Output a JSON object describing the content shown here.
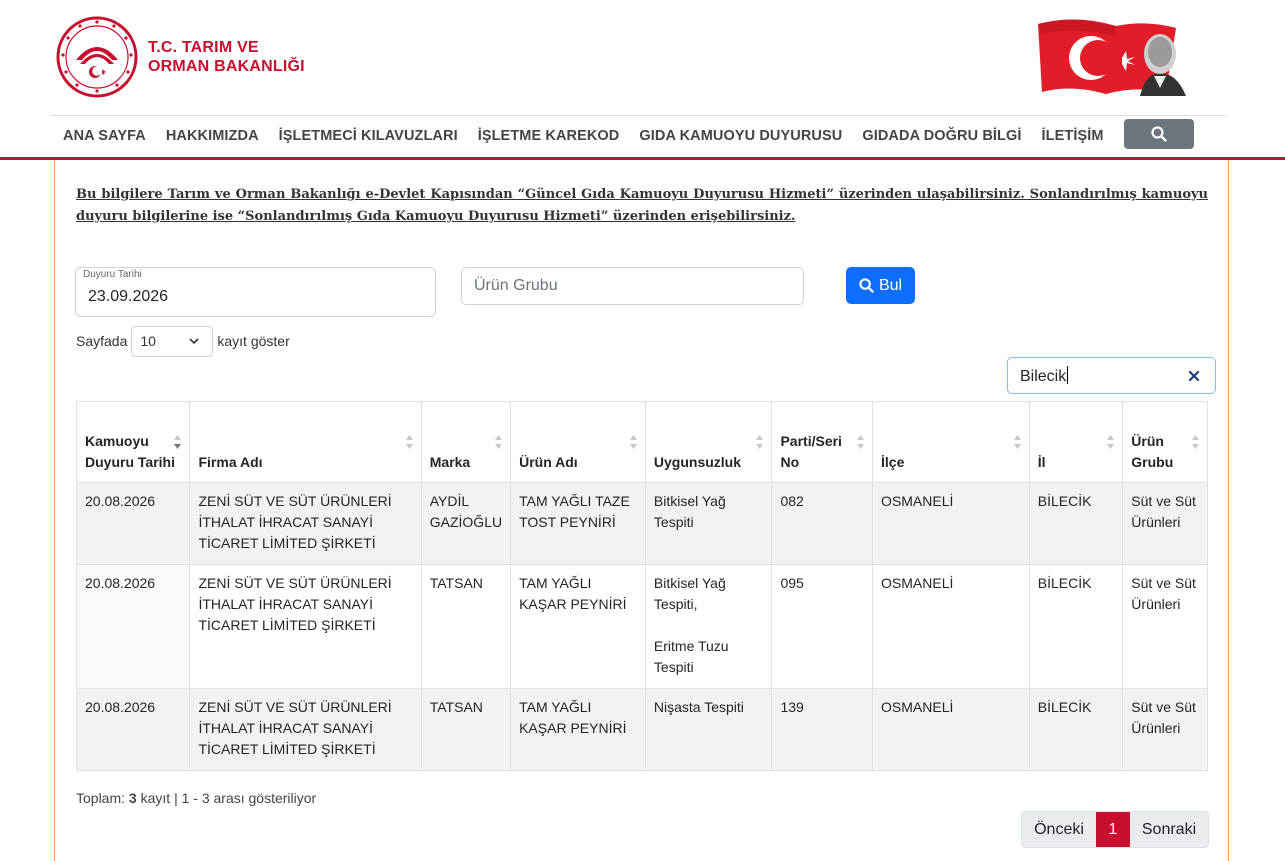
{
  "brand": {
    "line1": "T.C. TARIM VE",
    "line2": "ORMAN BAKANLIĞI"
  },
  "nav": {
    "items": [
      "ANA SAYFA",
      "HAKKIMIZDA",
      "İŞLETMECİ KILAVUZLARI",
      "İŞLETME KAREKOD",
      "GIDA KAMUOYU DUYURUSU",
      "GIDADA DOĞRU BİLGİ",
      "İLETİŞİM"
    ]
  },
  "notice": "Bu bilgilere Tarım ve Orman Bakanlığı e-Devlet Kapısından “Güncel Gıda Kamuoyu Duyurusu Hizmeti” üzerinden ulaşabilirsiniz. Sonlandırılmış kamuoyu duyuru bilgilerine ise “Sonlandırılmış Gıda Kamuoyu Duyurusu Hizmeti” üzerinden erişebilirsiniz.",
  "filters": {
    "date_label": "Duyuru Tarihi",
    "date_value": "23.09.2026",
    "group_placeholder": "Ürün Grubu",
    "find_label": "Bul"
  },
  "length": {
    "prefix": "Sayfada",
    "value": "10",
    "suffix": "kayıt göster"
  },
  "search": {
    "value": "Bilecik"
  },
  "table": {
    "headers": [
      "Kamuoyu Duyuru Tarihi",
      "Firma Adı",
      "Marka",
      "Ürün Adı",
      "Uygunsuzluk",
      "Parti/Seri No",
      "İlçe",
      "İl",
      "Ürün Grubu"
    ],
    "rows": [
      {
        "date": "20.08.2026",
        "company": "ZENİ SÜT VE SÜT ÜRÜNLERİ İTHALAT İHRACAT SANAYİ TİCARET LİMİTED ŞİRKETİ",
        "brand": "AYDİL GAZİOĞLU",
        "product": "TAM YAĞLI TAZE TOST PEYNİRİ",
        "issue1": "Bitkisel Yağ Tespiti",
        "issue2": "",
        "batch": "082",
        "district": "OSMANELİ",
        "city": "BİLECİK",
        "group": "Süt ve Süt Ürünleri"
      },
      {
        "date": "20.08.2026",
        "company": "ZENİ SÜT VE SÜT ÜRÜNLERİ İTHALAT İHRACAT SANAYİ TİCARET LİMİTED ŞİRKETİ",
        "brand": "TATSAN",
        "product": "TAM YAĞLI KAŞAR PEYNİRİ",
        "issue1": "Bitkisel Yağ Tespiti,",
        "issue2": "Eritme Tuzu Tespiti",
        "batch": "095",
        "district": "OSMANELİ",
        "city": "BİLECİK",
        "group": "Süt ve Süt Ürünleri"
      },
      {
        "date": "20.08.2026",
        "company": "ZENİ SÜT VE SÜT ÜRÜNLERİ İTHALAT İHRACAT SANAYİ TİCARET LİMİTED ŞİRKETİ",
        "brand": "TATSAN",
        "product": "TAM YAĞLI KAŞAR PEYNİRİ",
        "issue1": "Nişasta Tespiti",
        "issue2": "",
        "batch": "139",
        "district": "OSMANELİ",
        "city": "BİLECİK",
        "group": "Süt ve Süt Ürünleri"
      }
    ]
  },
  "summary": {
    "prefix": "Toplam:",
    "count": "3",
    "suffix": "kayıt | 1 - 3 arası gösteriliyor"
  },
  "pager": {
    "prev": "Önceki",
    "current": "1",
    "next": "Sonraki"
  },
  "colors": {
    "brand_red": "#c8102e",
    "primary": "#0d6efd",
    "frame": "#e6a15c"
  }
}
